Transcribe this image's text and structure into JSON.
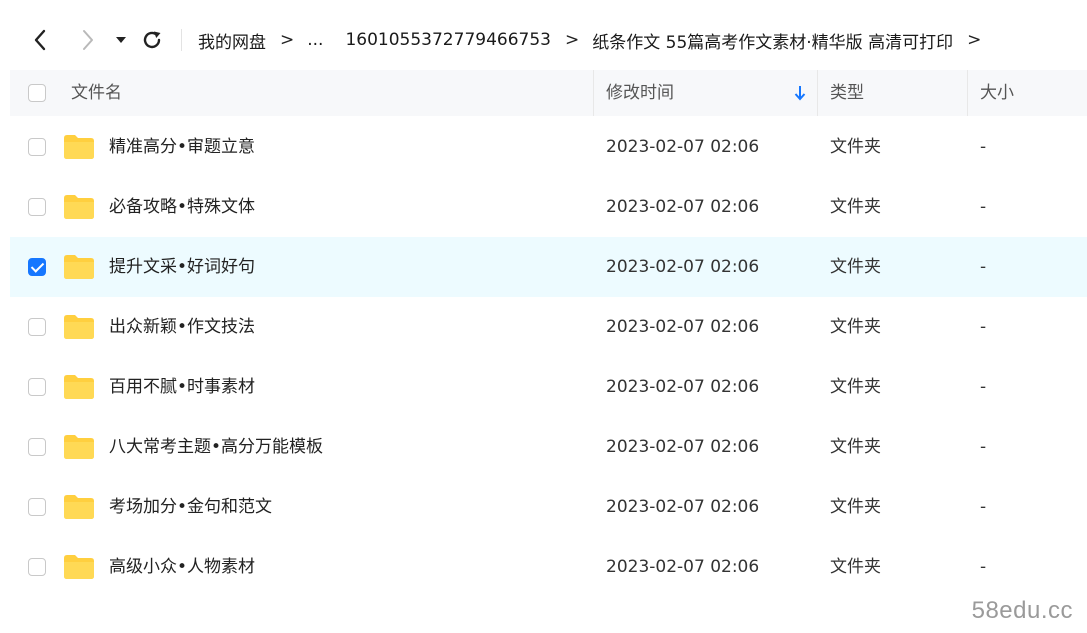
{
  "toolbar": {
    "back_icon": "chevron-left-icon",
    "forward_icon": "chevron-right-icon",
    "dropdown_icon": "caret-down-icon",
    "refresh_icon": "refresh-icon"
  },
  "breadcrumb": {
    "items": [
      "我的网盘",
      "...",
      "1601055372779466753",
      "纸条作文 55篇高考作文素材·精华版 高清可打印"
    ],
    "separator": ">"
  },
  "table": {
    "headers": {
      "name": "文件名",
      "modified": "修改时间",
      "type": "类型",
      "size": "大小"
    },
    "sort_icon": "arrow-down-icon",
    "sort_color": "#1677ff",
    "rows": [
      {
        "name": "精准高分•审题立意",
        "modified": "2023-02-07 02:06",
        "type": "文件夹",
        "size": "-",
        "checked": false
      },
      {
        "name": "必备攻略•特殊文体",
        "modified": "2023-02-07 02:06",
        "type": "文件夹",
        "size": "-",
        "checked": false
      },
      {
        "name": "提升文采•好词好句",
        "modified": "2023-02-07 02:06",
        "type": "文件夹",
        "size": "-",
        "checked": true
      },
      {
        "name": "出众新颖•作文技法",
        "modified": "2023-02-07 02:06",
        "type": "文件夹",
        "size": "-",
        "checked": false
      },
      {
        "name": "百用不腻•时事素材",
        "modified": "2023-02-07 02:06",
        "type": "文件夹",
        "size": "-",
        "checked": false
      },
      {
        "name": "八大常考主题•高分万能模板",
        "modified": "2023-02-07 02:06",
        "type": "文件夹",
        "size": "-",
        "checked": false
      },
      {
        "name": "考场加分•金句和范文",
        "modified": "2023-02-07 02:06",
        "type": "文件夹",
        "size": "-",
        "checked": false
      },
      {
        "name": "高级小众•人物素材",
        "modified": "2023-02-07 02:06",
        "type": "文件夹",
        "size": "-",
        "checked": false
      }
    ]
  },
  "colors": {
    "folder": "#ffcf3f",
    "selected_row": "#edfbff",
    "accent": "#1677ff"
  },
  "watermark": "58edu.cc"
}
